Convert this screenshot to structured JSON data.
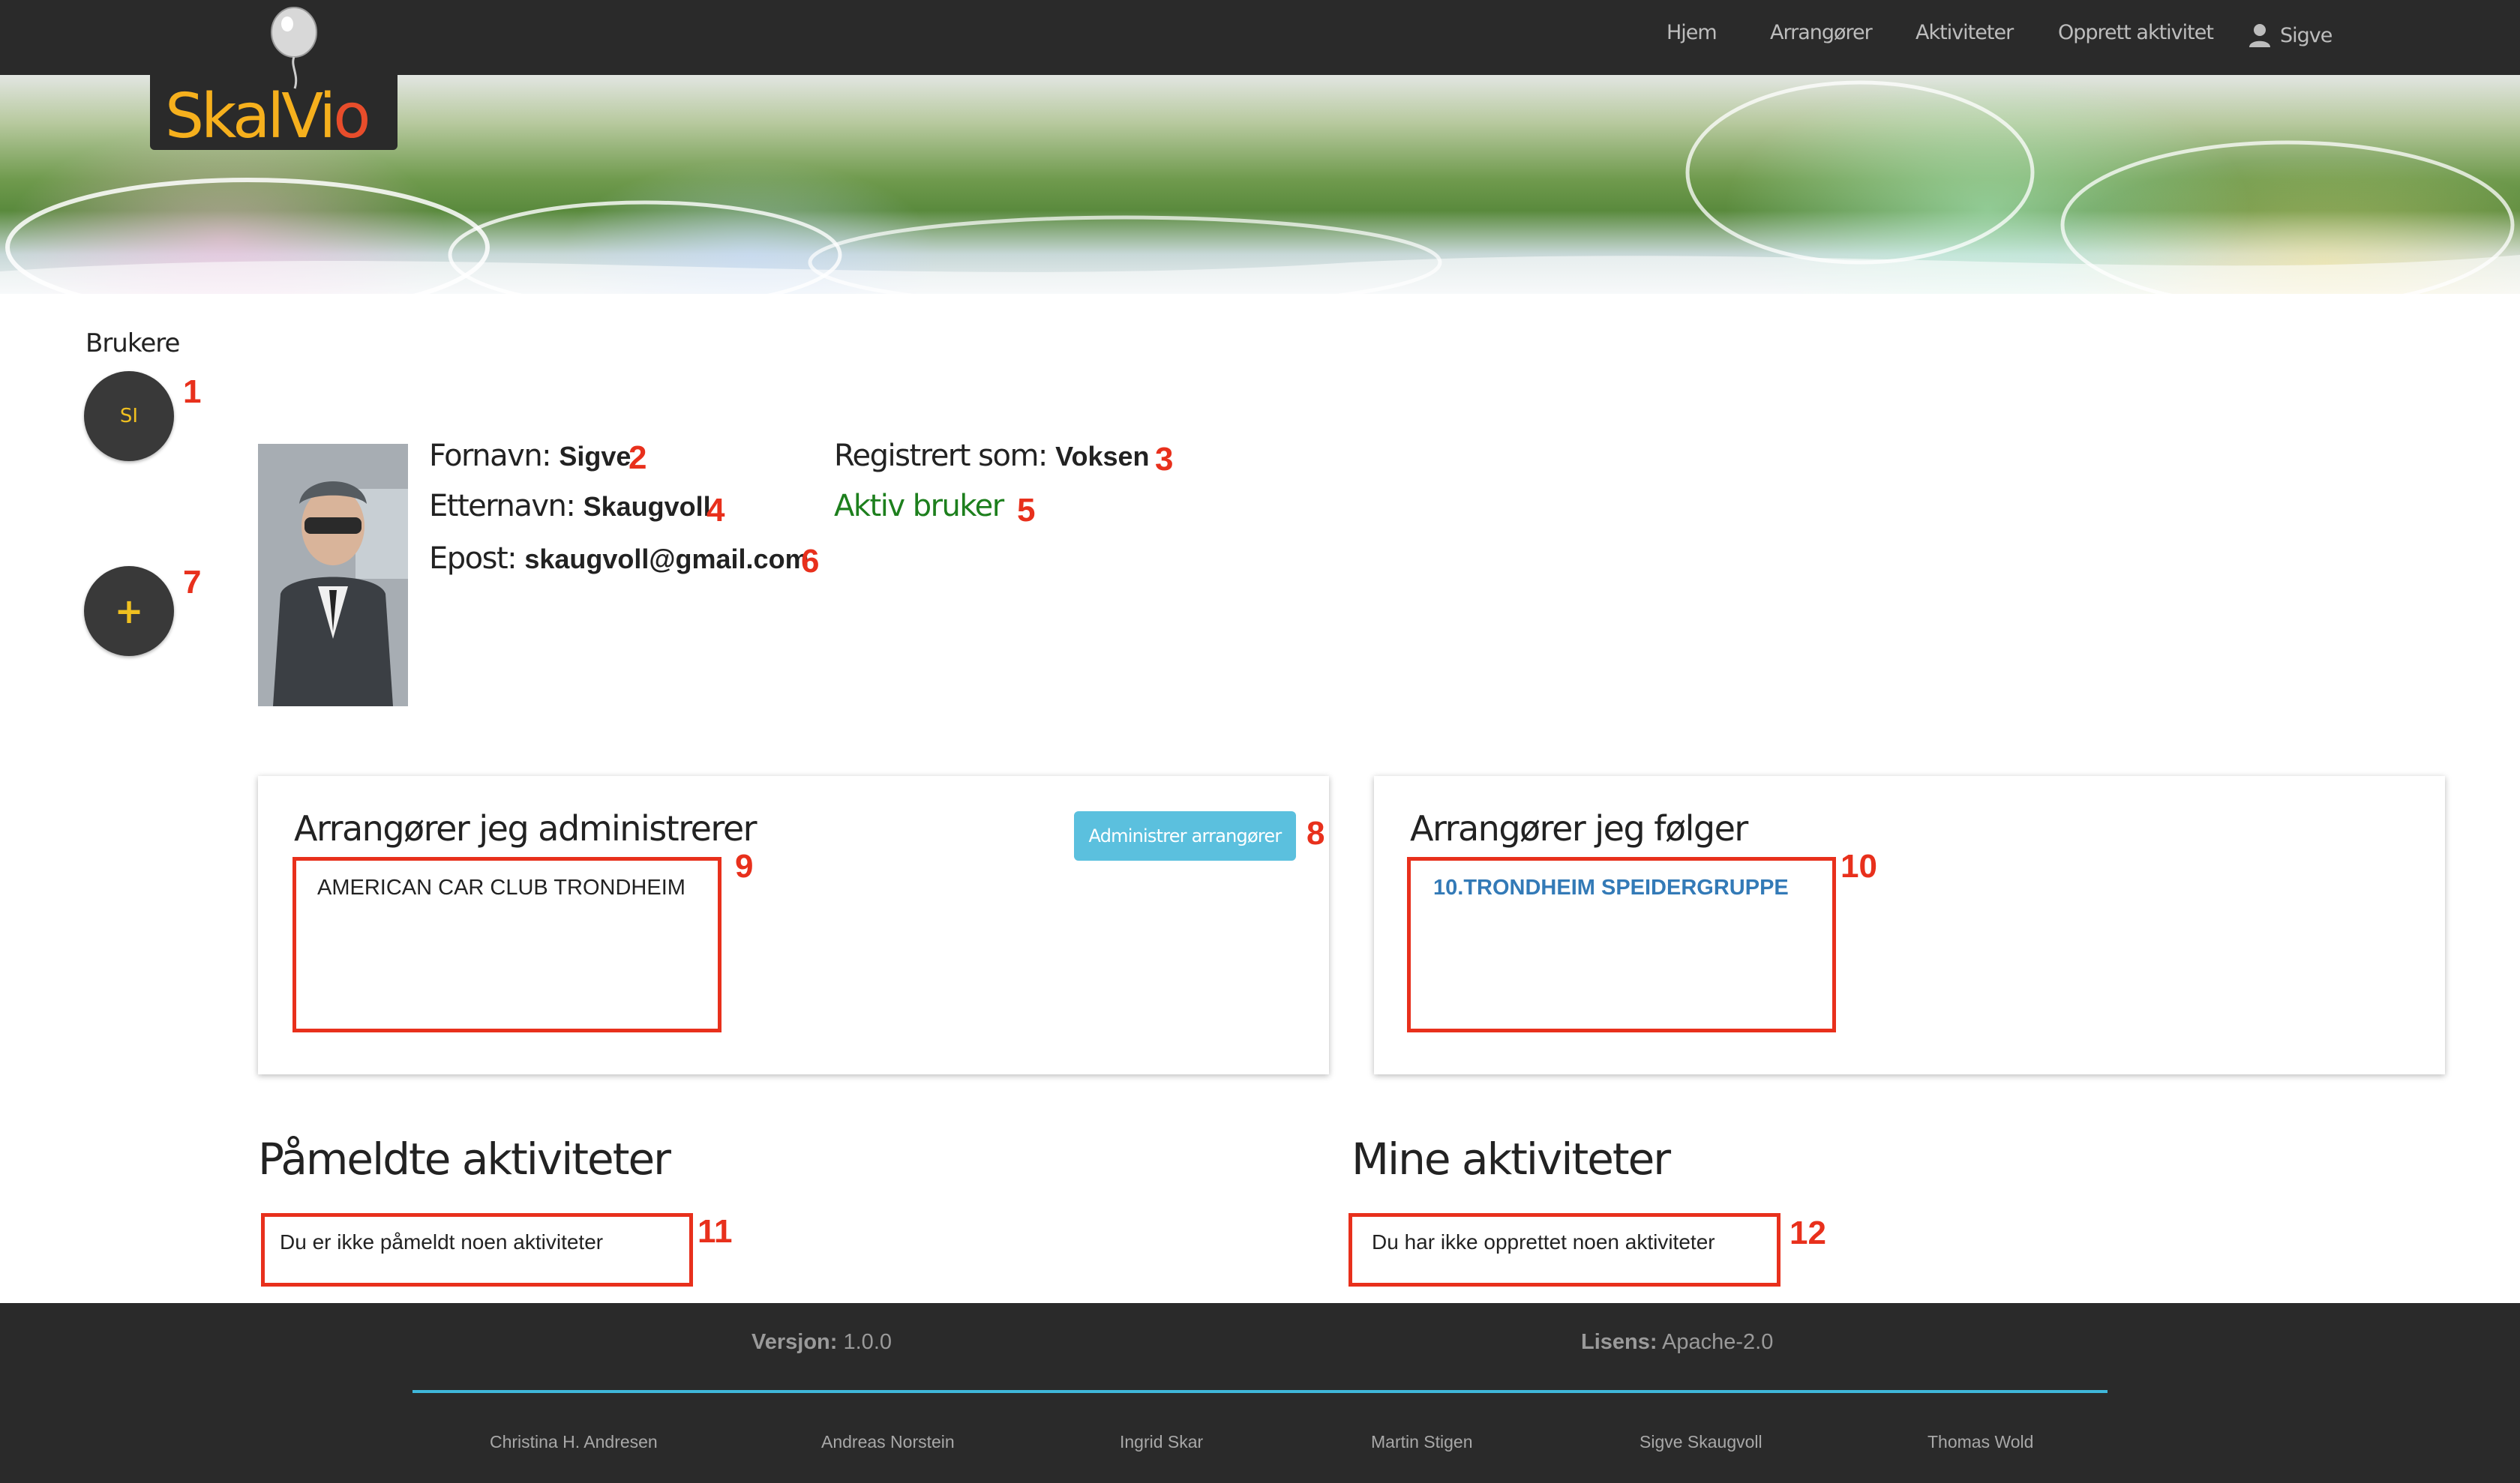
{
  "nav": {
    "items": [
      "Hjem",
      "Arrangører",
      "Aktiviteter",
      "Opprett aktivitet"
    ],
    "user_name": "Sigve",
    "user_icon": "user-icon"
  },
  "logo": {
    "text": "SkalVi",
    "text_end": "o",
    "balloon_icon": "balloon-icon"
  },
  "sidebar": {
    "label": "Brukere",
    "user_initials": "SI",
    "add_label": "+"
  },
  "markers": [
    "1",
    "2",
    "3",
    "4",
    "5",
    "6",
    "7",
    "8",
    "9",
    "10",
    "11",
    "12"
  ],
  "profile": {
    "first_name_label": "Fornavn:",
    "first_name": "Sigve",
    "last_name_label": "Etternavn:",
    "last_name": "Skaugvoll",
    "email_label": "Epost:",
    "email": "skaugvoll@gmail.com",
    "registered_label": "Registrert som:",
    "registered_as": "Voksen",
    "status": "Aktiv bruker",
    "status_color": "#1d7f1d"
  },
  "cards": {
    "admin": {
      "title": "Arrangører jeg administrerer",
      "button": "Administrer arrangører",
      "items": [
        "AMERICAN CAR CLUB TRONDHEIM"
      ]
    },
    "following": {
      "title": "Arrangører jeg følger",
      "items": [
        "10.TRONDHEIM SPEIDERGRUPPE"
      ]
    }
  },
  "sections": {
    "signed_up": {
      "title": "Påmeldte aktiviteter",
      "empty": "Du er ikke påmeldt noen aktiviteter"
    },
    "mine": {
      "title": "Mine aktiviteter",
      "empty": "Du har ikke opprettet noen aktiviteter"
    }
  },
  "footer": {
    "version_label": "Versjon:",
    "version": "1.0.0",
    "license_label": "Lisens:",
    "license": "Apache-2.0",
    "authors": [
      "Christina H. Andresen",
      "Andreas Norstein",
      "Ingrid Skar",
      "Martin Stigen",
      "Sigve Skaugvoll",
      "Thomas Wold"
    ]
  },
  "colors": {
    "navbar": "#2a2a2a",
    "accent": "#f0c020",
    "button": "#5bc0de",
    "link": "#337ab7",
    "highlight": "#e8301c",
    "footer_line": "#3fb7da"
  }
}
